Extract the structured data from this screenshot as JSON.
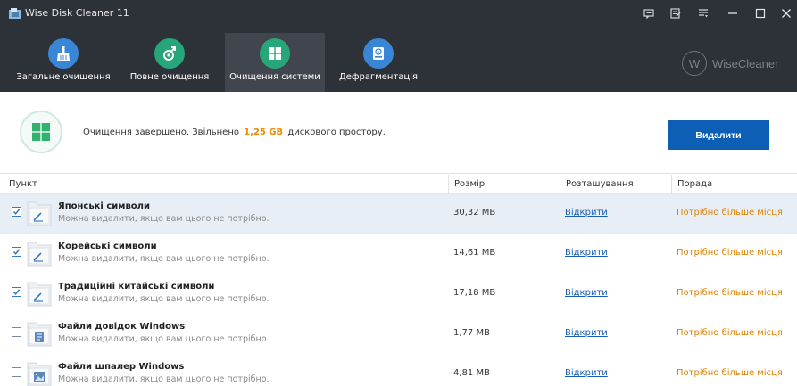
{
  "window": {
    "title": "Wise Disk Cleaner 11",
    "controls": [
      "feedback-icon",
      "notes-icon",
      "menu-icon",
      "minimize-icon",
      "maximize-icon",
      "close-icon"
    ]
  },
  "nav": {
    "tabs": [
      {
        "label": "Загальне очищення",
        "icon": "broom-icon",
        "color": "#3a86d6",
        "active": false
      },
      {
        "label": "Повне очищення",
        "icon": "deep-clean-icon",
        "color": "#27a67a",
        "active": false
      },
      {
        "label": "Очищення системи",
        "icon": "windows-icon",
        "color": "#27a67a",
        "active": true
      },
      {
        "label": "Дефрагментація",
        "icon": "disk-icon",
        "color": "#3a86d6",
        "active": false
      }
    ]
  },
  "brand": {
    "logo_letter": "W",
    "name": "WiseCleaner"
  },
  "status": {
    "text_before": "Очищення завершено. Звільнено",
    "freed": "1,25 GB",
    "text_after": "дискового простору.",
    "delete_button": "Видалити",
    "accent": "#0c5fb4"
  },
  "table": {
    "headers": {
      "item": "Пункт",
      "size": "Розмір",
      "location": "Розташування",
      "advice": "Порада"
    },
    "rows": [
      {
        "title": "Японські символи",
        "desc": "Можна видалити, якщо вам цього не потрібно.",
        "size": "30,32 MB",
        "location": "Відкрити",
        "advice": "Потрібно більше місця",
        "checked": true,
        "icon": "font-icon"
      },
      {
        "title": "Корейські символи",
        "desc": "Можна видалити, якщо вам цього не потрібно.",
        "size": "14,61 MB",
        "location": "Відкрити",
        "advice": "Потрібно більше місця",
        "checked": true,
        "icon": "font-icon"
      },
      {
        "title": "Традиційні китайські символи",
        "desc": "Можна видалити, якщо вам цього не потрібно.",
        "size": "17,18 MB",
        "location": "Відкрити",
        "advice": "Потрібно більше місця",
        "checked": true,
        "icon": "font-icon"
      },
      {
        "title": "Файли довідок Windows",
        "desc": "Можна видалити, якщо вам цього не потрібно.",
        "size": "1,77 MB",
        "location": "Відкрити",
        "advice": "Потрібно більше місця",
        "checked": false,
        "icon": "help-file-icon"
      },
      {
        "title": "Файли шпалер Windows",
        "desc": "Можна видалити, якщо вам цього не потрібно.",
        "size": "4,81 MB",
        "location": "Відкрити",
        "advice": "Потрібно більше місця",
        "checked": false,
        "icon": "wallpaper-icon"
      }
    ]
  }
}
